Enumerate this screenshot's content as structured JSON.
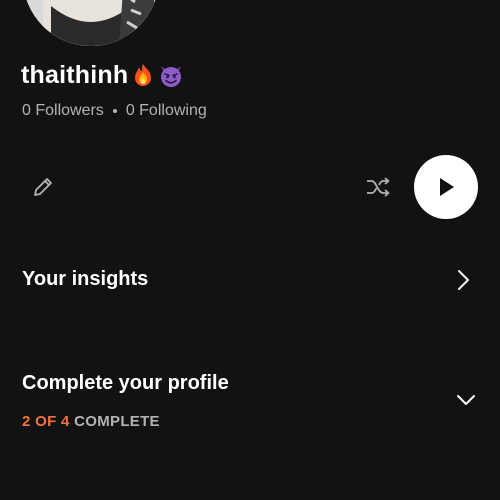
{
  "profile": {
    "username": "thaithinh",
    "emojis": [
      "fire-emoji",
      "smiling-devil-emoji"
    ],
    "followers_label": "0 Followers",
    "following_label": "0 Following"
  },
  "actions": {
    "edit_icon": "pencil-icon",
    "shuffle_icon": "shuffle-icon",
    "play_icon": "play-icon"
  },
  "insights": {
    "label": "Your insights",
    "icon": "chevron-right-icon"
  },
  "complete_profile": {
    "title": "Complete your profile",
    "progress_count": "2 OF 4",
    "progress_suffix": "COMPLETE",
    "completed_steps": 2,
    "total_steps": 4,
    "icon": "chevron-down-icon"
  },
  "colors": {
    "background": "#121212",
    "text_primary": "#ffffff",
    "text_secondary": "#b3b3b3",
    "accent_progress": "#f0743e"
  }
}
